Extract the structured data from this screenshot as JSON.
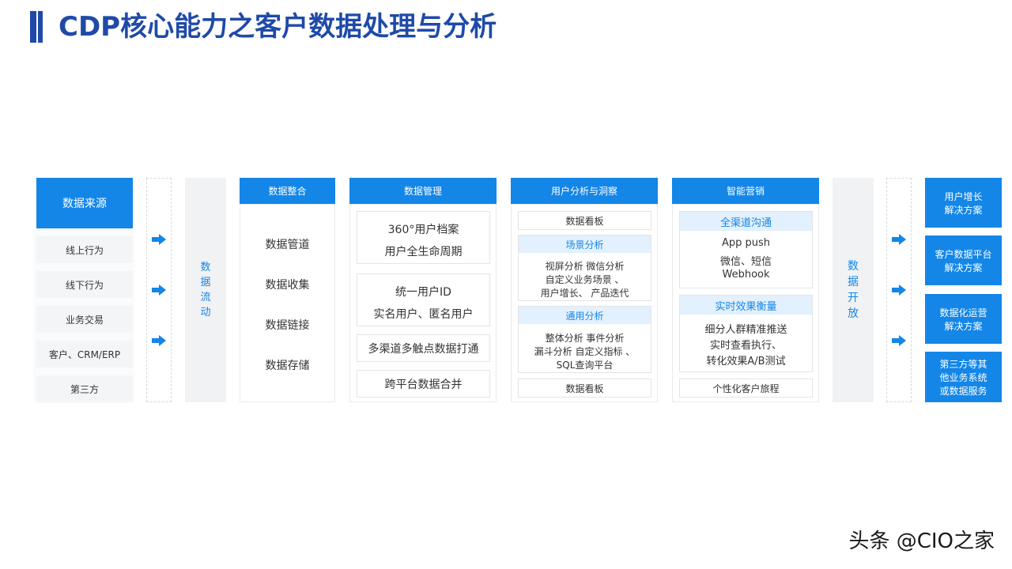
{
  "title": "CDP核心能力之客户数据处理与分析",
  "sources": {
    "header": "数据来源",
    "items": [
      "线上行为",
      "线下行为",
      "业务交易",
      "客户、CRM/ERP",
      "第三方"
    ]
  },
  "data_flow": "数\n据\n流\n动",
  "integration": {
    "header": "数据整合",
    "items": [
      "数据管道",
      "数据收集",
      "数据链接",
      "数据存储"
    ]
  },
  "management": {
    "header": "数据管理",
    "box1": [
      "360°用户档案",
      "用户全生命周期"
    ],
    "box2": [
      "统一用户ID",
      "实名用户、匿名用户"
    ],
    "box3": "多渠道多触点数据打通",
    "box4": "跨平台数据合并"
  },
  "analysis": {
    "header": "用户分析与洞察",
    "top_box": "数据看板",
    "scene_head": "场景分析",
    "scene_lines": [
      "视屏分析 微信分析",
      "自定义业务场景 、",
      "用户增长、 产品迭代"
    ],
    "general_head": "通用分析",
    "general_lines": [
      "整体分析 事件分析",
      "漏斗分析 自定义指标 、",
      "SQL查询平台"
    ],
    "bottom_box": "数据看板"
  },
  "marketing": {
    "header": "智能营销",
    "omni_head": "全渠道沟通",
    "omni_lines": [
      "App push",
      "微信、短信",
      "Webhook"
    ],
    "realtime_head": "实时效果衡量",
    "realtime_lines": [
      "细分人群精准推送",
      "实时查看执行、",
      "转化效果A/B测试"
    ],
    "bottom_box": "个性化客户旅程"
  },
  "data_open": "数\n据\n开\n放",
  "outputs": [
    [
      "用户增长",
      "解决方案"
    ],
    [
      "客户数据平台",
      "解决方案"
    ],
    [
      "数据化运营",
      "解决方案"
    ],
    [
      "第三方等其",
      "他业务系统",
      "或数据服务"
    ]
  ],
  "watermark": "头条 @CIO之家",
  "colors": {
    "accent": "#1386e8",
    "title": "#1f4aa8",
    "light": "#e3f0fd",
    "grey": "#f4f5f7"
  },
  "icons": [
    "right-arrow-icon"
  ]
}
